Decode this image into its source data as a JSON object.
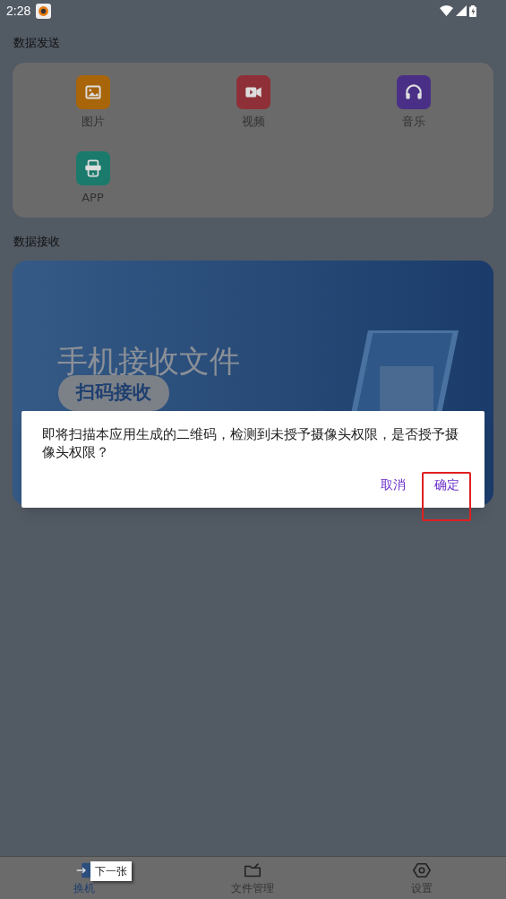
{
  "status_bar": {
    "time": "2:28"
  },
  "send": {
    "title": "数据发送",
    "items": [
      {
        "label": "图片",
        "kind": "image",
        "color": "#a8650a"
      },
      {
        "label": "视频",
        "kind": "video",
        "color": "#8f3038"
      },
      {
        "label": "音乐",
        "kind": "music",
        "color": "#4a2f86"
      },
      {
        "label": "APP",
        "kind": "app",
        "color": "#1a7a6c"
      }
    ]
  },
  "receive": {
    "title": "数据接收",
    "banner": {
      "title": "手机接收文件",
      "button": "扫码接收"
    }
  },
  "dialog": {
    "message": "即将扫描本应用生成的二维码，检测到未授予摄像头权限，是否授予摄像头权限？",
    "buttons": [
      {
        "label": "取消",
        "annotated": false
      },
      {
        "label": "确定",
        "annotated": true
      }
    ]
  },
  "tab_bar": {
    "items": [
      {
        "label": "换机",
        "kind": "swap",
        "selected": true
      },
      {
        "label": "文件管理",
        "kind": "folder",
        "selected": false
      },
      {
        "label": "设置",
        "kind": "settings",
        "selected": false
      }
    ]
  },
  "tooltip": "下一张"
}
